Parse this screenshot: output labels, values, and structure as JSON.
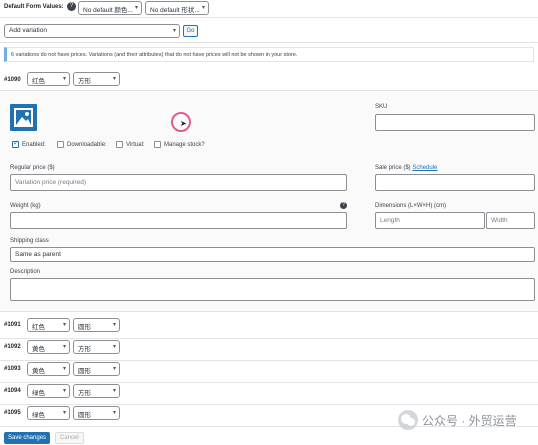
{
  "default_form": {
    "label": "Default Form Values:",
    "select1": "No default 颜色...",
    "select2": "No default 形状..."
  },
  "add_variation": {
    "select": "Add variation",
    "go": "Go"
  },
  "notice": "6 variations do not have prices. Variations (and their attributes) that do not have prices will not be shown in your store.",
  "expanded": {
    "id": "#1090",
    "color": "红色",
    "shape": "方形",
    "sku_label": "SKU",
    "enabled_label": "Enabled:",
    "downloadable_label": "Downloadable:",
    "virtual_label": "Virtual:",
    "manage_stock_label": "Manage stock?",
    "regular_price_label": "Regular price ($)",
    "regular_price_placeholder": "Variation price (required)",
    "sale_price_label": "Sale price ($)",
    "schedule_link": "Schedule",
    "weight_label": "Weight (kg)",
    "dimensions_label": "Dimensions (L×W×H) (cm)",
    "length_placeholder": "Length",
    "width_placeholder": "Width",
    "shipping_class_label": "Shipping class",
    "shipping_class_value": "Same as parent",
    "description_label": "Description"
  },
  "variations": [
    {
      "id": "#1091",
      "color": "红色",
      "shape": "圆形"
    },
    {
      "id": "#1092",
      "color": "黄色",
      "shape": "方形"
    },
    {
      "id": "#1093",
      "color": "黄色",
      "shape": "圆形"
    },
    {
      "id": "#1094",
      "color": "绿色",
      "shape": "方形"
    },
    {
      "id": "#1095",
      "color": "绿色",
      "shape": "圆形"
    }
  ],
  "footer": {
    "save": "Save changes",
    "cancel": "Cancel"
  },
  "watermark": "公众号 · 外贸运营",
  "colors": {
    "accent": "#2271b1",
    "cursor_ring": "#e35b8f"
  }
}
